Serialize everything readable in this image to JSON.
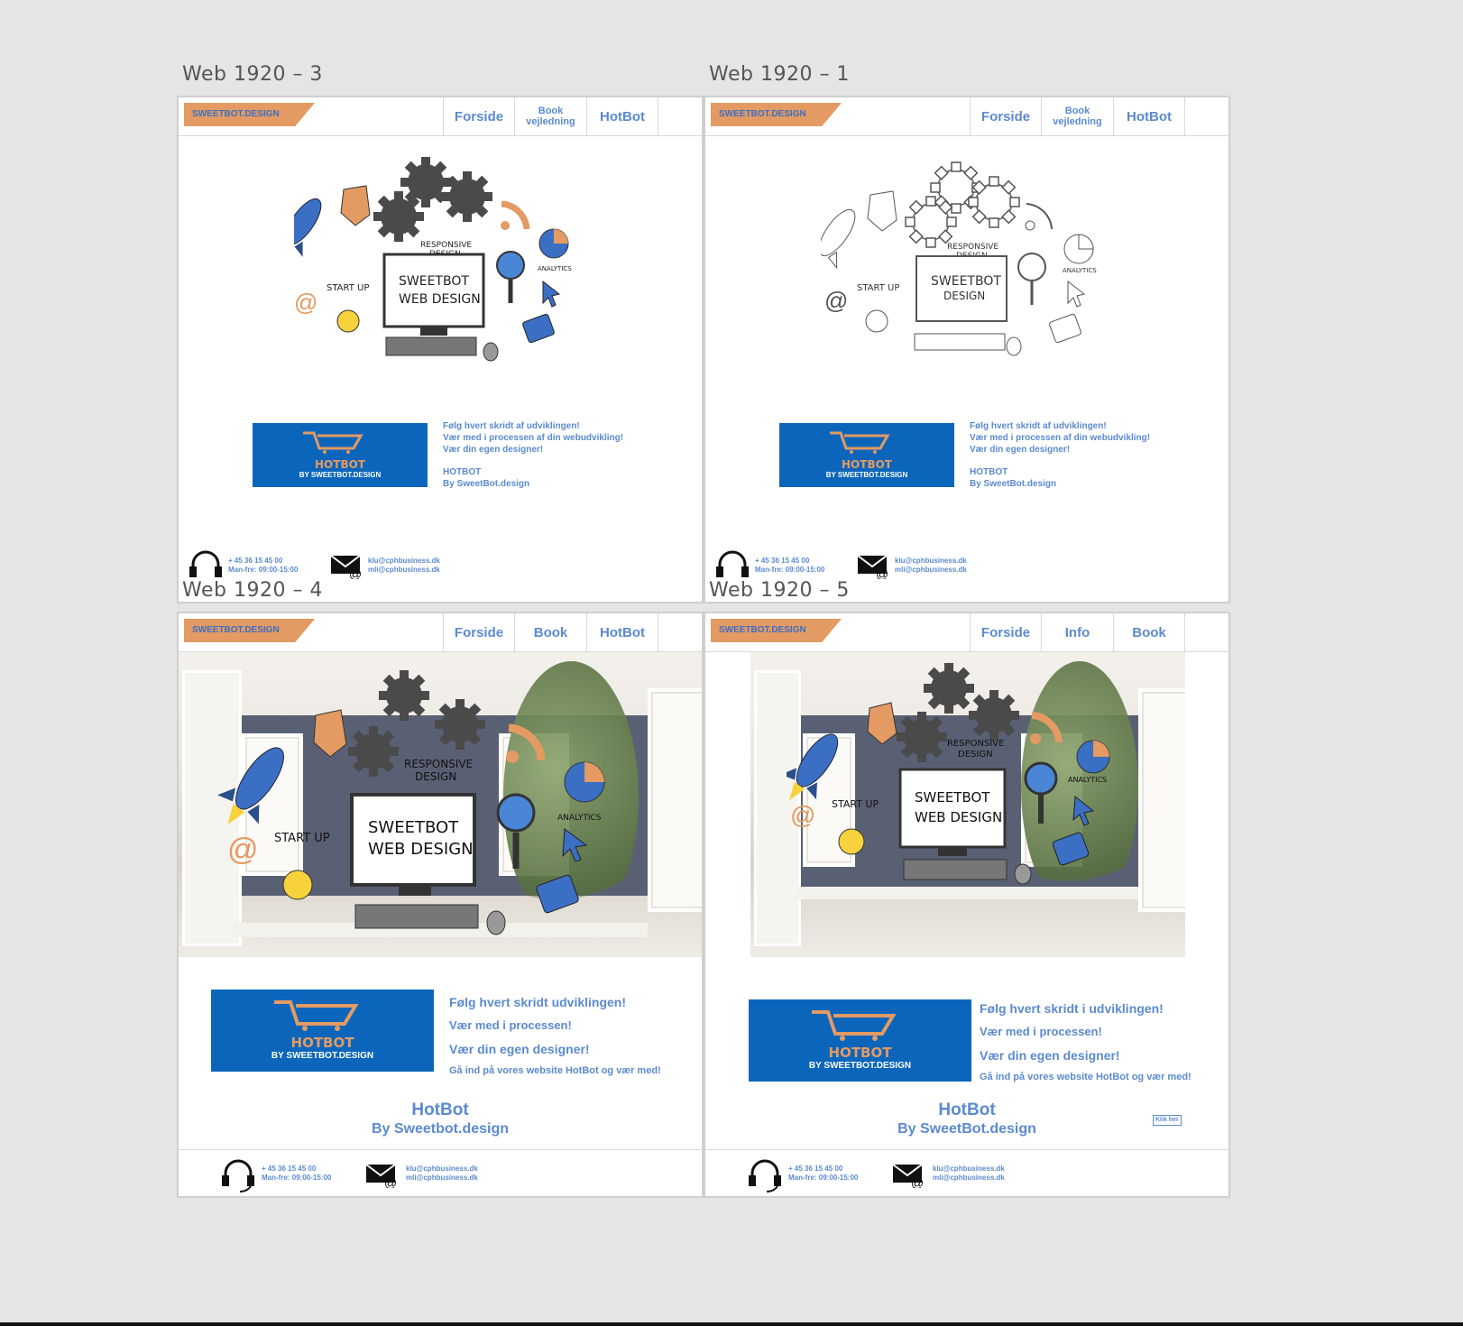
{
  "frames": [
    {
      "title": "Web 1920 – 3",
      "logo": "SWEETBOT.DESIGN",
      "nav": [
        "Forside",
        "Book vejledning",
        "HotBot"
      ],
      "illustration": {
        "text1": "RESPONSIVE",
        "text2": "DESIGN",
        "screen1": "SWEETBOT",
        "screen2": "WEB DESIGN",
        "startup": "START UP",
        "analytics": "ANALYTICS"
      },
      "banner": {
        "word": "HOTBOT",
        "by": "BY SWEETBOT.DESIGN"
      },
      "copy": [
        "Følg hvert skridt af udviklingen!",
        "Vær med i processen af din webudvikling!",
        "Vær din egen designer!"
      ],
      "brand": [
        "HOTBOT",
        "By SweetBot.design"
      ],
      "phone": [
        "+ 45 36 15 45 00",
        "Man-fre: 09:00-15:00"
      ],
      "email": [
        "klu@cphbusiness.dk",
        "mli@cphbusiness.dk"
      ]
    },
    {
      "title": "Web 1920 – 1",
      "logo": "SWEETBOT.DESIGN",
      "nav": [
        "Forside",
        "Book vejledning",
        "HotBot"
      ],
      "illustration": {
        "text1": "RESPONSIVE",
        "text2": "DESIGN",
        "screen1": "SWEETBOT",
        "screen2": "DESIGN",
        "startup": "START UP",
        "analytics": "ANALYTICS"
      },
      "banner": {
        "word": "HOTBOT",
        "by": "BY SWEETBOT.DESIGN"
      },
      "copy": [
        "Følg hvert skridt af udviklingen!",
        "Vær med i processen af din webudvikling!",
        "Vær din egen designer!"
      ],
      "brand": [
        "HOTBOT",
        "By SweetBot.design"
      ],
      "phone": [
        "+ 45 36 15 45 00",
        "Man-fre: 09:00-15:00"
      ],
      "email": [
        "klu@cphbusiness.dk",
        "mli@cphbusiness.dk"
      ]
    },
    {
      "title": "Web 1920 – 4",
      "logo": "SWEETBOT.DESIGN",
      "nav": [
        "Forside",
        "Book",
        "HotBot"
      ],
      "illustration": {
        "text1": "RESPONSIVE",
        "text2": "DESIGN",
        "screen1": "SWEETBOT",
        "screen2": "WEB DESIGN",
        "startup": "START UP",
        "analytics": "ANALYTICS"
      },
      "banner": {
        "word": "HOTBOT",
        "by": "BY SWEETBOT.DESIGN"
      },
      "copy": [
        "Følg hvert skridt udviklingen!",
        "Vær med i processen!",
        "Vær din egen designer!",
        "Gå ind på vores website HotBot og vær med!"
      ],
      "brand": [
        "HotBot",
        "By Sweetbot.design"
      ],
      "phone": [
        "+ 45 36 15 45 00",
        "Man-fre: 09:00-15:00"
      ],
      "email": [
        "klu@cphbusiness.dk",
        "mli@cphbusiness.dk"
      ]
    },
    {
      "title": "Web 1920 – 5",
      "logo": "SWEETBOT.DESIGN",
      "nav": [
        "Forside",
        "Info",
        "Book"
      ],
      "illustration": {
        "text1": "RESPONSIVE",
        "text2": "DESIGN",
        "screen1": "SWEETBOT",
        "screen2": "WEB DESIGN",
        "startup": "START UP",
        "analytics": "ANALYTICS"
      },
      "banner": {
        "word": "HOTBOT",
        "by": "BY SWEETBOT.DESIGN"
      },
      "copy": [
        "Følg hvert skridt i udviklingen!",
        "Vær med i processen!",
        "Vær din egen designer!",
        "Gå ind på vores website HotBot og vær med!"
      ],
      "brand": [
        "HotBot",
        "By SweetBot.design"
      ],
      "cta": "Klik her",
      "phone": [
        "+ 45 36 15 45 00",
        "Man-fre: 09:00-15:00"
      ],
      "email": [
        "klu@cphbusiness.dk",
        "mli@cphbusiness.dk"
      ]
    }
  ],
  "colors": {
    "accent": "#5b8ad0",
    "logo_bg": "#e39a63",
    "banner_bg": "#0b66bb",
    "canvas_bg": "#e5e5e5"
  }
}
